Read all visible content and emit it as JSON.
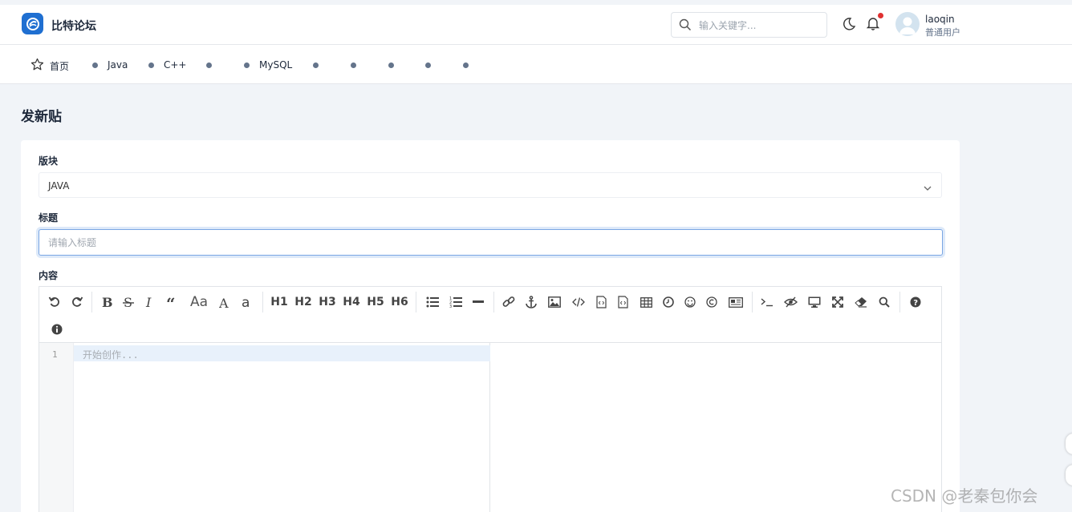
{
  "header": {
    "brand": "比特论坛",
    "search_placeholder": "输入关键字...",
    "user_name": "laoqin",
    "user_role": "普通用户"
  },
  "nav": {
    "home": "首页",
    "items": [
      "Java",
      "C++",
      "",
      "MySQL",
      "",
      "",
      "",
      "",
      ""
    ]
  },
  "page": {
    "title": "发新贴"
  },
  "form": {
    "board_label": "版块",
    "board_value": "JAVA",
    "title_label": "标题",
    "title_placeholder": "请输入标题",
    "content_label": "内容"
  },
  "editor": {
    "toolbar_text": {
      "font_size": "Aa",
      "h1": "H1",
      "h2": "H2",
      "h3": "H3",
      "h4": "H4",
      "h5": "H5",
      "h6": "H6"
    },
    "line_number": "1",
    "placeholder": "开始创作..."
  },
  "watermark": "CSDN @老秦包你会",
  "colors": {
    "brand": "#1f6fd1",
    "notification": "#e03131",
    "focus_border": "#7aa6e3",
    "page_bg": "#f1f4f8"
  }
}
